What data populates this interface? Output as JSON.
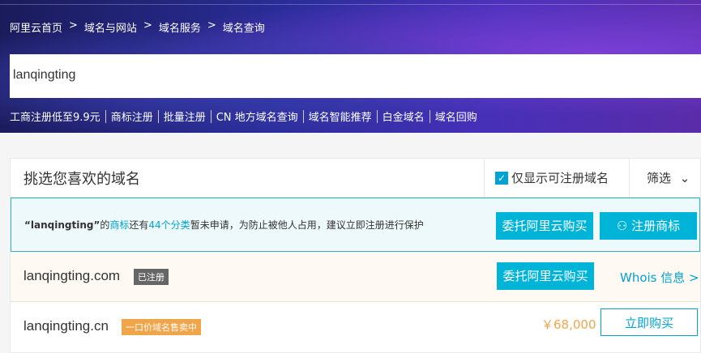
{
  "breadcrumb": [
    "阿里云首页",
    "域名与网站",
    "域名服务",
    "域名查询"
  ],
  "breadcrumb_sep": ">",
  "search": {
    "value": "lanqingting"
  },
  "quick_links": [
    "工商注册低至9.9元",
    "商标注册",
    "批量注册",
    "CN 地方域名查询",
    "域名智能推荐",
    "白金域名",
    "域名回购"
  ],
  "panel": {
    "title": "挑选您喜欢的域名",
    "only_available_label": "仅显示可注册域名",
    "only_available_checked": true,
    "filter_label": "筛选"
  },
  "notice": {
    "keyword": "“lanqingting”",
    "t1": "的",
    "link1": "商标",
    "t2": "还有",
    "link2": "44个分类",
    "t3": "暂未申请，为防止被他人占用，建议立即注册进行保护",
    "btn_broker": "委托阿里云购买",
    "btn_trademark": "注册商标"
  },
  "results": [
    {
      "domain": "lanqingting.com",
      "tag": "已注册",
      "button": "委托阿里云购买",
      "whois": "Whois 信息 >"
    },
    {
      "domain": "lanqingting.cn",
      "tag": "一口价域名售卖中",
      "price": "￥68,000",
      "button": "立即购买"
    }
  ],
  "colors": {
    "accent": "#00b4d8",
    "orange": "#f0a54a"
  }
}
